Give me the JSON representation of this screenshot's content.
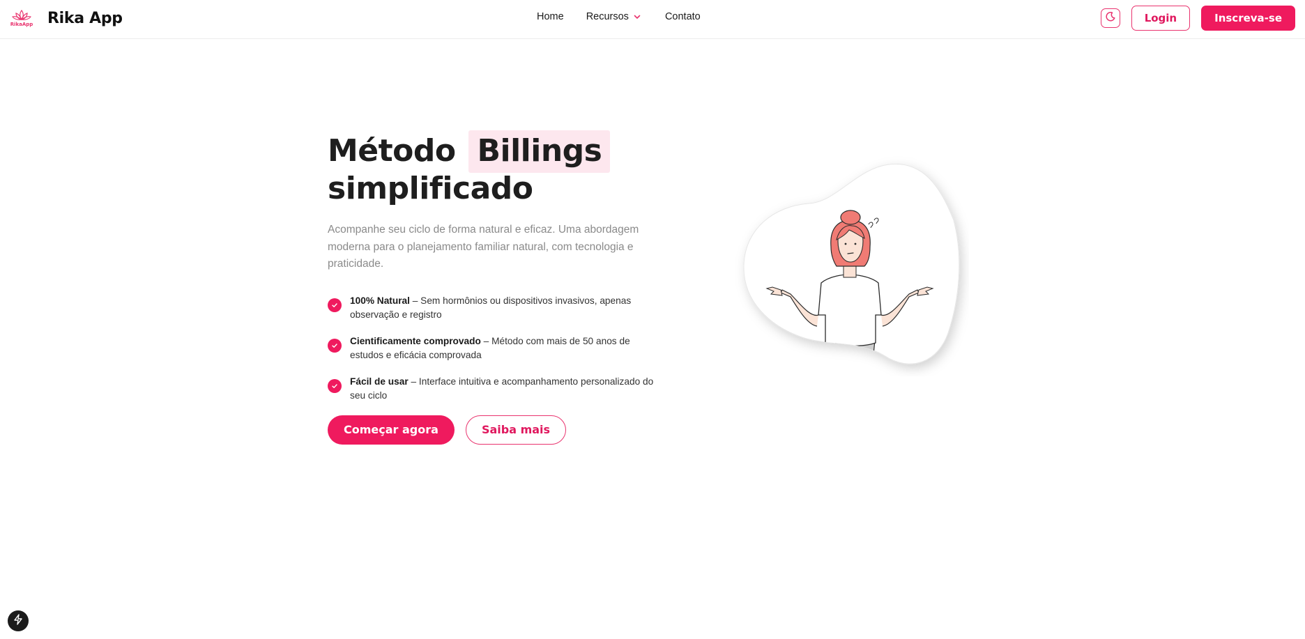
{
  "brand": {
    "logo_text": "RikaApp",
    "name": "Rika App",
    "logo_icon": "lotus-icon"
  },
  "nav": {
    "home": "Home",
    "recursos": "Recursos",
    "contato": "Contato"
  },
  "header_actions": {
    "theme_icon": "moon-icon",
    "login": "Login",
    "signup": "Inscreva-se"
  },
  "hero": {
    "title_part1": "Método",
    "title_highlight": "Billings",
    "title_line2": "simplificado",
    "subtitle": "Acompanhe seu ciclo de forma natural e eficaz. Uma abordagem moderna para o planejamento familiar natural, com tecnologia e praticidade.",
    "features": [
      {
        "strong": "100% Natural",
        "text": " – Sem hormônios ou dispositivos invasivos, apenas observação e registro"
      },
      {
        "strong": "Cientificamente comprovado",
        "text": " – Método com mais de 50 anos de estudos e eficácia comprovada"
      },
      {
        "strong": "Fácil de usar",
        "text": " – Interface intuitiva e acompanhamento personalizado do seu ciclo"
      }
    ],
    "cta_primary": "Começar agora",
    "cta_secondary": "Saiba mais"
  },
  "colors": {
    "accent": "#ef1a5e",
    "highlight_bg": "#fde7ee",
    "subtitle_gray": "#8a8a8a"
  },
  "floating": {
    "icon": "lightning-icon"
  }
}
